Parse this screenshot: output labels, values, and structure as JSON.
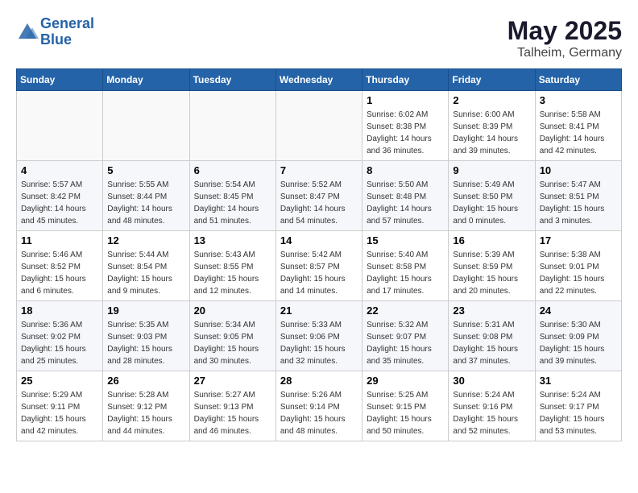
{
  "header": {
    "logo_line1": "General",
    "logo_line2": "Blue",
    "month_title": "May 2025",
    "location": "Talheim, Germany"
  },
  "weekdays": [
    "Sunday",
    "Monday",
    "Tuesday",
    "Wednesday",
    "Thursday",
    "Friday",
    "Saturday"
  ],
  "weeks": [
    [
      {
        "day": "",
        "info": ""
      },
      {
        "day": "",
        "info": ""
      },
      {
        "day": "",
        "info": ""
      },
      {
        "day": "",
        "info": ""
      },
      {
        "day": "1",
        "info": "Sunrise: 6:02 AM\nSunset: 8:38 PM\nDaylight: 14 hours\nand 36 minutes."
      },
      {
        "day": "2",
        "info": "Sunrise: 6:00 AM\nSunset: 8:39 PM\nDaylight: 14 hours\nand 39 minutes."
      },
      {
        "day": "3",
        "info": "Sunrise: 5:58 AM\nSunset: 8:41 PM\nDaylight: 14 hours\nand 42 minutes."
      }
    ],
    [
      {
        "day": "4",
        "info": "Sunrise: 5:57 AM\nSunset: 8:42 PM\nDaylight: 14 hours\nand 45 minutes."
      },
      {
        "day": "5",
        "info": "Sunrise: 5:55 AM\nSunset: 8:44 PM\nDaylight: 14 hours\nand 48 minutes."
      },
      {
        "day": "6",
        "info": "Sunrise: 5:54 AM\nSunset: 8:45 PM\nDaylight: 14 hours\nand 51 minutes."
      },
      {
        "day": "7",
        "info": "Sunrise: 5:52 AM\nSunset: 8:47 PM\nDaylight: 14 hours\nand 54 minutes."
      },
      {
        "day": "8",
        "info": "Sunrise: 5:50 AM\nSunset: 8:48 PM\nDaylight: 14 hours\nand 57 minutes."
      },
      {
        "day": "9",
        "info": "Sunrise: 5:49 AM\nSunset: 8:50 PM\nDaylight: 15 hours\nand 0 minutes."
      },
      {
        "day": "10",
        "info": "Sunrise: 5:47 AM\nSunset: 8:51 PM\nDaylight: 15 hours\nand 3 minutes."
      }
    ],
    [
      {
        "day": "11",
        "info": "Sunrise: 5:46 AM\nSunset: 8:52 PM\nDaylight: 15 hours\nand 6 minutes."
      },
      {
        "day": "12",
        "info": "Sunrise: 5:44 AM\nSunset: 8:54 PM\nDaylight: 15 hours\nand 9 minutes."
      },
      {
        "day": "13",
        "info": "Sunrise: 5:43 AM\nSunset: 8:55 PM\nDaylight: 15 hours\nand 12 minutes."
      },
      {
        "day": "14",
        "info": "Sunrise: 5:42 AM\nSunset: 8:57 PM\nDaylight: 15 hours\nand 14 minutes."
      },
      {
        "day": "15",
        "info": "Sunrise: 5:40 AM\nSunset: 8:58 PM\nDaylight: 15 hours\nand 17 minutes."
      },
      {
        "day": "16",
        "info": "Sunrise: 5:39 AM\nSunset: 8:59 PM\nDaylight: 15 hours\nand 20 minutes."
      },
      {
        "day": "17",
        "info": "Sunrise: 5:38 AM\nSunset: 9:01 PM\nDaylight: 15 hours\nand 22 minutes."
      }
    ],
    [
      {
        "day": "18",
        "info": "Sunrise: 5:36 AM\nSunset: 9:02 PM\nDaylight: 15 hours\nand 25 minutes."
      },
      {
        "day": "19",
        "info": "Sunrise: 5:35 AM\nSunset: 9:03 PM\nDaylight: 15 hours\nand 28 minutes."
      },
      {
        "day": "20",
        "info": "Sunrise: 5:34 AM\nSunset: 9:05 PM\nDaylight: 15 hours\nand 30 minutes."
      },
      {
        "day": "21",
        "info": "Sunrise: 5:33 AM\nSunset: 9:06 PM\nDaylight: 15 hours\nand 32 minutes."
      },
      {
        "day": "22",
        "info": "Sunrise: 5:32 AM\nSunset: 9:07 PM\nDaylight: 15 hours\nand 35 minutes."
      },
      {
        "day": "23",
        "info": "Sunrise: 5:31 AM\nSunset: 9:08 PM\nDaylight: 15 hours\nand 37 minutes."
      },
      {
        "day": "24",
        "info": "Sunrise: 5:30 AM\nSunset: 9:09 PM\nDaylight: 15 hours\nand 39 minutes."
      }
    ],
    [
      {
        "day": "25",
        "info": "Sunrise: 5:29 AM\nSunset: 9:11 PM\nDaylight: 15 hours\nand 42 minutes."
      },
      {
        "day": "26",
        "info": "Sunrise: 5:28 AM\nSunset: 9:12 PM\nDaylight: 15 hours\nand 44 minutes."
      },
      {
        "day": "27",
        "info": "Sunrise: 5:27 AM\nSunset: 9:13 PM\nDaylight: 15 hours\nand 46 minutes."
      },
      {
        "day": "28",
        "info": "Sunrise: 5:26 AM\nSunset: 9:14 PM\nDaylight: 15 hours\nand 48 minutes."
      },
      {
        "day": "29",
        "info": "Sunrise: 5:25 AM\nSunset: 9:15 PM\nDaylight: 15 hours\nand 50 minutes."
      },
      {
        "day": "30",
        "info": "Sunrise: 5:24 AM\nSunset: 9:16 PM\nDaylight: 15 hours\nand 52 minutes."
      },
      {
        "day": "31",
        "info": "Sunrise: 5:24 AM\nSunset: 9:17 PM\nDaylight: 15 hours\nand 53 minutes."
      }
    ]
  ]
}
